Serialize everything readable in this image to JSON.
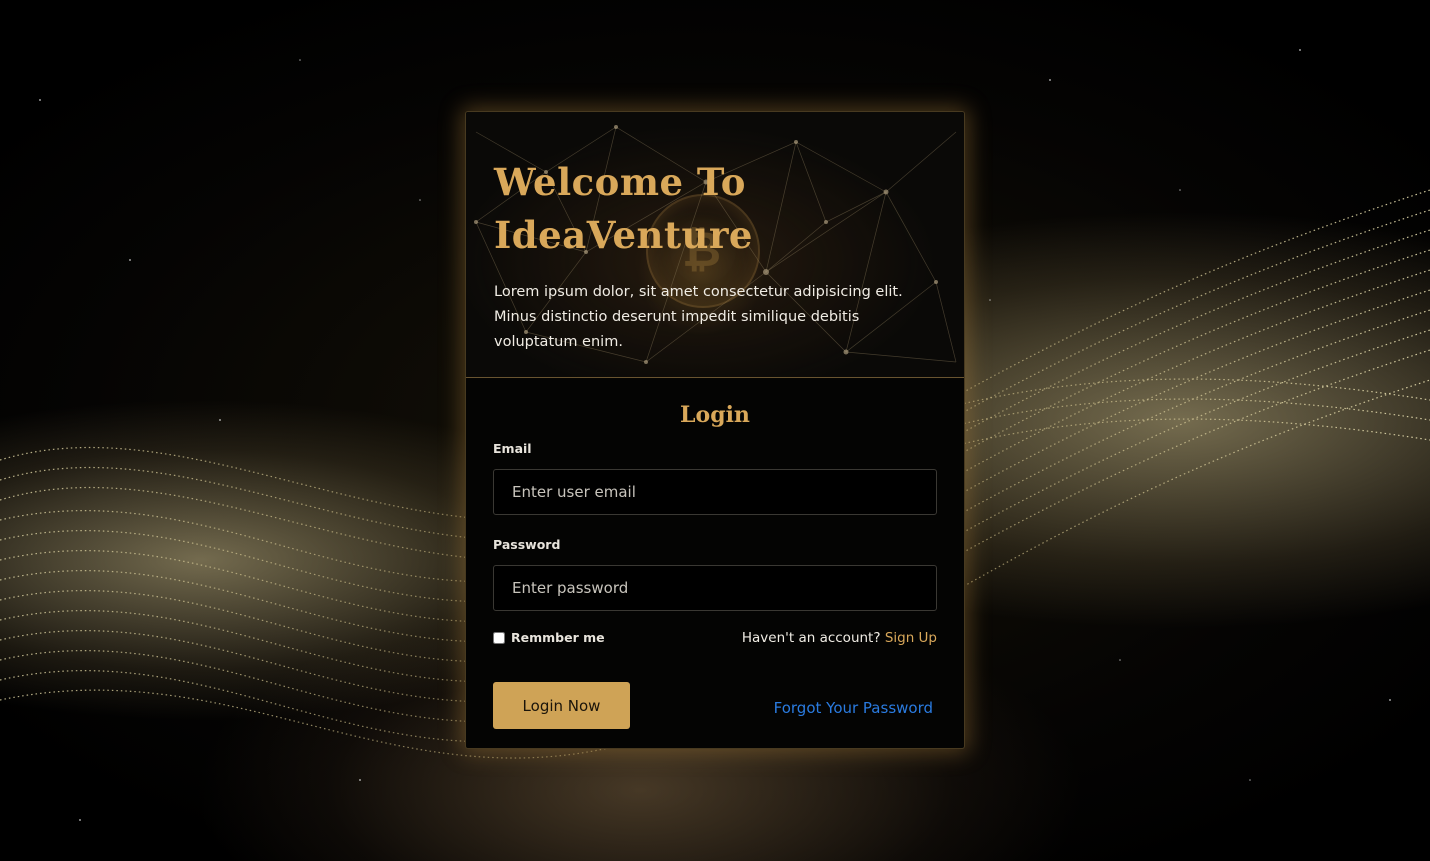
{
  "hero": {
    "title": "Welcome To IdeaVenture",
    "description": "Lorem ipsum dolor, sit amet consectetur adipisicing elit. Minus distinctio deserunt impedit similique debitis voluptatum enim."
  },
  "form": {
    "title": "Login",
    "email_label": "Email",
    "email_placeholder": "Enter user email",
    "password_label": "Password",
    "password_placeholder": "Enter password",
    "remember_label": "Remmber me",
    "signup_prompt": "Haven't an account? ",
    "signup_link": "Sign Up",
    "submit_label": "Login Now",
    "forgot_link": "Forgot Your Password"
  },
  "colors": {
    "accent": "#d9a85a",
    "button": "#cfa356",
    "link": "#2a7be0",
    "card_bg": "#040403"
  }
}
